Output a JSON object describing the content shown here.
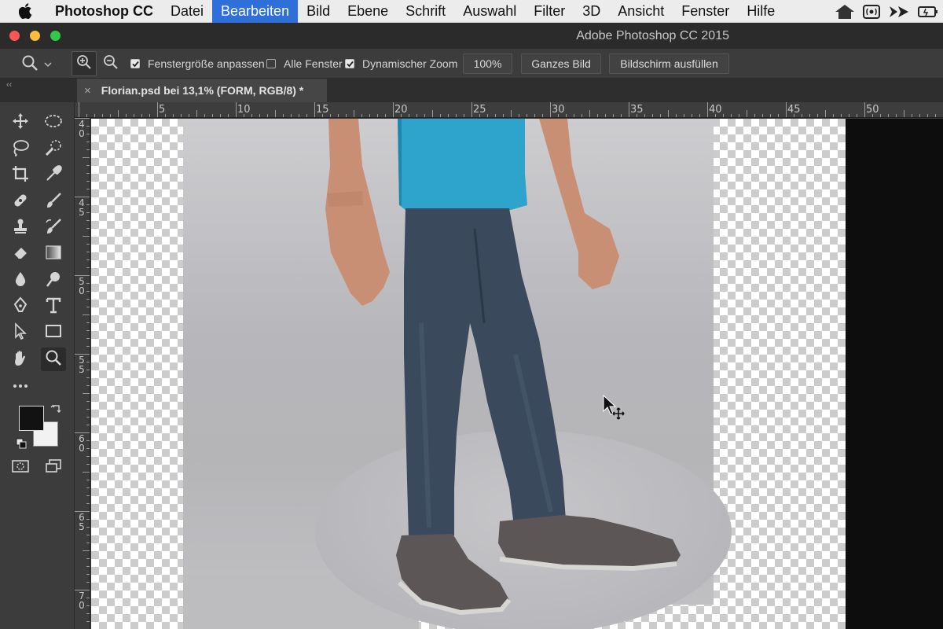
{
  "menubar": {
    "app_name": "Photoshop CC",
    "items": [
      "Datei",
      "Bearbeiten",
      "Bild",
      "Ebene",
      "Schrift",
      "Auswahl",
      "Filter",
      "3D",
      "Ansicht",
      "Fenster",
      "Hilfe"
    ],
    "active_item": "Bearbeiten"
  },
  "window": {
    "title": "Adobe Photoshop CC 2015"
  },
  "options": {
    "resize_windows_label": "Fenstergröße anpassen",
    "resize_windows_checked": true,
    "all_windows_label": "Alle Fenster",
    "all_windows_checked": false,
    "scrubby_zoom_label": "Dynamischer Zoom",
    "scrubby_zoom_checked": true,
    "zoom_value": "100%",
    "fit_screen_label": "Ganzes Bild",
    "fill_screen_label": "Bildschirm ausfüllen"
  },
  "document": {
    "tab_title": "Florian.psd bei 13,1% (FORM, RGB/8) *"
  },
  "rulers": {
    "horizontal": [
      "5",
      "10",
      "15",
      "20",
      "25",
      "30",
      "35",
      "40",
      "45",
      "50"
    ],
    "vertical": [
      "40",
      "45",
      "50",
      "55",
      "60",
      "65",
      "70"
    ]
  },
  "colors": {
    "menu_active": "#2e6fd9",
    "foreground": "#121212",
    "background": "#f2f2f2",
    "tshirt": "#2ea3cc",
    "jeans": "#3a4a5c",
    "shoes": "#5d5656"
  }
}
